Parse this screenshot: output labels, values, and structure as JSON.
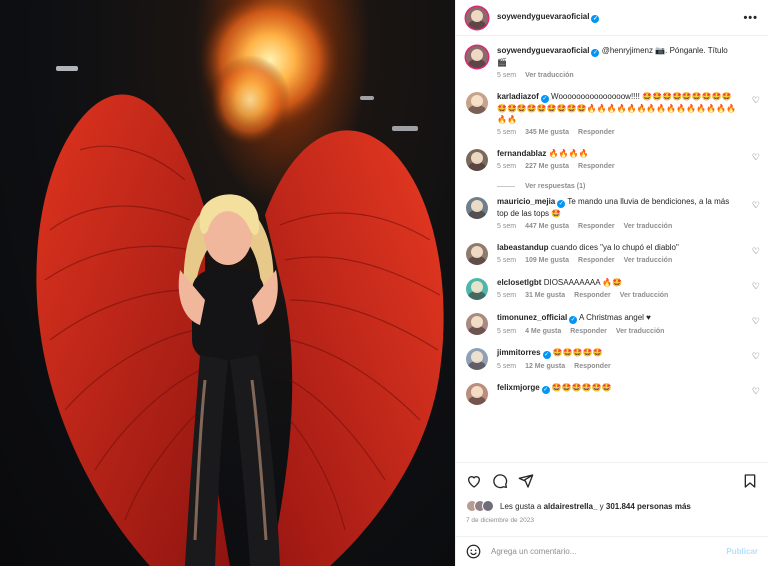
{
  "post": {
    "username": "soywendyguevaraoficial",
    "more_label": "•••",
    "caption_user": "soywendyguevaraoficial",
    "caption_text": "@henryjimenz 📷. Pónganle. Título 🎬",
    "caption_time": "5 sem",
    "caption_translate": "Ver traducción"
  },
  "comments": [
    {
      "user": "karladiazof",
      "verified": true,
      "text": "Wooooooooooooooow!!!! 🤩🤩🤩🤩🤩🤩🤩🤩🤩🤩🤩🤩🤩🤩🤩🤩🤩🤩🔥🔥🔥🔥🔥🔥🔥🔥🔥🔥🔥🔥🔥🔥🔥🔥🔥",
      "time": "5 sem",
      "likes": "345 Me gusta",
      "reply": "Responder",
      "translate": ""
    },
    {
      "user": "fernandablaz",
      "verified": false,
      "text": "🔥🔥🔥🔥",
      "time": "5 sem",
      "likes": "227 Me gusta",
      "reply": "Responder",
      "translate": ""
    },
    {
      "user": "mauricio_mejia",
      "verified": true,
      "text": "Te mando una lluvia de bendiciones, a la más top de las tops 🤩",
      "time": "5 sem",
      "likes": "447 Me gusta",
      "reply": "Responder",
      "translate": "Ver traducción"
    },
    {
      "user": "labeastandup",
      "verified": false,
      "text": "cuando dices \"ya lo chupó el diablo\"",
      "time": "5 sem",
      "likes": "109 Me gusta",
      "reply": "Responder",
      "translate": "Ver traducción"
    },
    {
      "user": "elclosetlgbt",
      "verified": false,
      "text": "DIOSAAAAAAA 🔥🤩",
      "time": "5 sem",
      "likes": "31 Me gusta",
      "reply": "Responder",
      "translate": "Ver traducción"
    },
    {
      "user": "timonunez_official",
      "verified": true,
      "text": "A Christmas angel ♥",
      "time": "5 sem",
      "likes": "4 Me gusta",
      "reply": "Responder",
      "translate": "Ver traducción"
    },
    {
      "user": "jimmitorres",
      "verified": true,
      "text": "🤩🤩🤩🤩🤩",
      "time": "5 sem",
      "likes": "12 Me gusta",
      "reply": "Responder",
      "translate": ""
    },
    {
      "user": "felixmjorge",
      "verified": true,
      "text": "🤩🤩🤩🤩🤩🤩",
      "time": "",
      "likes": "",
      "reply": "",
      "translate": ""
    }
  ],
  "view_replies": "Ver respuestas (1)",
  "likes_summary": {
    "prefix": "Les gusta a",
    "user": "aldairestrella_",
    "middle": "y",
    "count": "301.844",
    "suffix": "personas más"
  },
  "date": "7 de diciembre de 2023",
  "composer": {
    "placeholder": "Agrega un comentario...",
    "publish": "Publicar"
  },
  "colors": {
    "accent": "#0095f6",
    "ring": "#d62976",
    "wing": "#c8231a"
  },
  "icons": [
    "more-icon",
    "heart-icon",
    "comment-icon",
    "share-icon",
    "save-icon",
    "emoji-icon",
    "verified-icon"
  ]
}
